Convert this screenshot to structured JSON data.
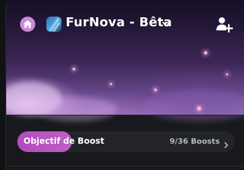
{
  "header": {
    "server_name": "FurNova - Bêta",
    "home_icon": "home-icon",
    "server_icon": "server-avatar",
    "dropdown_icon": "chevron-down-icon",
    "invite_icon": "add-user-icon"
  },
  "boost": {
    "label": "Objectif de Boost",
    "count_text": "9/36 Boosts",
    "progress": 0.25,
    "arrow_icon": "chevron-right-icon",
    "fill_color": "#b04dbd"
  },
  "colors": {
    "background": "#18191c",
    "home_badge": "#c98bd8",
    "accent": "#b04dbd"
  }
}
